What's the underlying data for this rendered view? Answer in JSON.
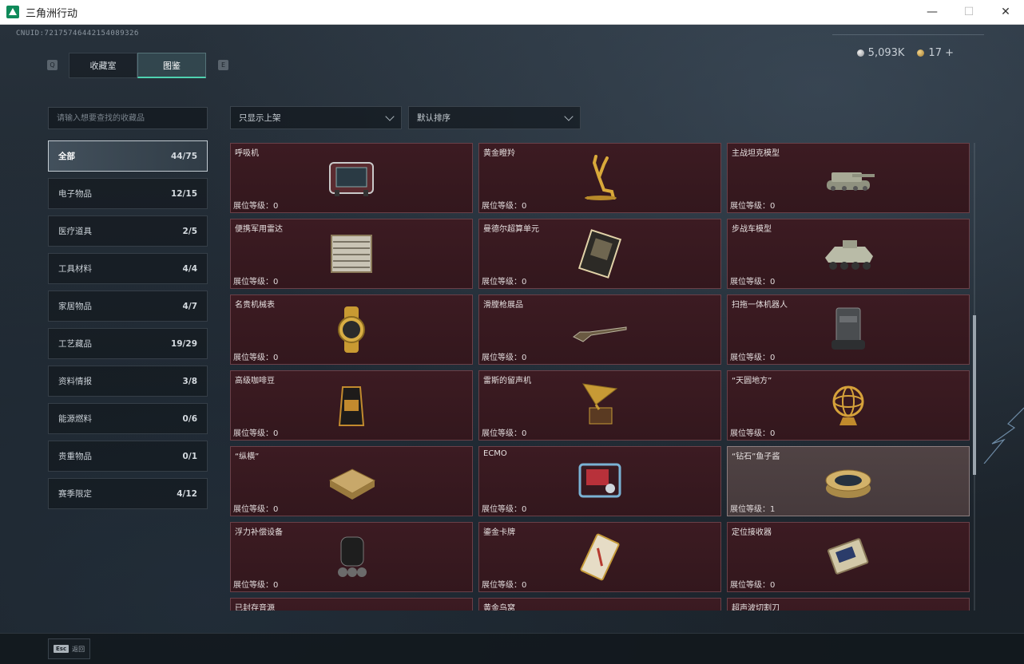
{
  "window": {
    "title": "三角洲行动",
    "minimize": "—",
    "maximize": "☐",
    "close": "✕"
  },
  "header": {
    "uid": "CNUID:7217574644215408932б",
    "currency": [
      {
        "icon": "silver-coin-icon",
        "value": "5,093K"
      },
      {
        "icon": "gold-coin-icon",
        "value": "17 +"
      }
    ]
  },
  "tabs": {
    "left_key": "Q",
    "right_key": "E",
    "items": [
      {
        "label": "收藏室",
        "active": false
      },
      {
        "label": "图鉴",
        "active": true
      }
    ]
  },
  "search": {
    "placeholder": "请输入想要查找的收藏品",
    "value": ""
  },
  "filters": {
    "availability": "只显示上架",
    "sort": "默认排序"
  },
  "categories": [
    {
      "label": "全部",
      "count": "44/75",
      "active": true
    },
    {
      "label": "电子物品",
      "count": "12/15",
      "active": false
    },
    {
      "label": "医疗道具",
      "count": "2/5",
      "active": false
    },
    {
      "label": "工具材料",
      "count": "4/4",
      "active": false
    },
    {
      "label": "家居物品",
      "count": "4/7",
      "active": false
    },
    {
      "label": "工艺藏品",
      "count": "19/29",
      "active": false
    },
    {
      "label": "资料情报",
      "count": "3/8",
      "active": false
    },
    {
      "label": "能源燃料",
      "count": "0/6",
      "active": false
    },
    {
      "label": "贵重物品",
      "count": "0/1",
      "active": false
    },
    {
      "label": "赛季限定",
      "count": "4/12",
      "active": false
    }
  ],
  "level_label": "展位等级：",
  "items": [
    {
      "name": "呼吸机",
      "level": "0",
      "icon": "ventilator-icon",
      "owned": false
    },
    {
      "name": "黄金瞪羚",
      "level": "0",
      "icon": "golden-gazelle-icon",
      "owned": false
    },
    {
      "name": "主战坦克模型",
      "level": "0",
      "icon": "tank-model-icon",
      "owned": false
    },
    {
      "name": "便携军用雷达",
      "level": "0",
      "icon": "radar-icon",
      "owned": false
    },
    {
      "name": "曼德尔超算单元",
      "level": "0",
      "icon": "supercomputer-unit-icon",
      "owned": false
    },
    {
      "name": "步战车模型",
      "level": "0",
      "icon": "ifv-model-icon",
      "owned": false
    },
    {
      "name": "名贵机械表",
      "level": "0",
      "icon": "watch-icon",
      "owned": false
    },
    {
      "name": "滑膛枪展品",
      "level": "0",
      "icon": "musket-icon",
      "owned": false
    },
    {
      "name": "扫拖一体机器人",
      "level": "0",
      "icon": "robot-vacuum-icon",
      "owned": false
    },
    {
      "name": "高级咖啡豆",
      "level": "0",
      "icon": "coffee-bag-icon",
      "owned": false
    },
    {
      "name": "雷斯的留声机",
      "level": "0",
      "icon": "gramophone-icon",
      "owned": false
    },
    {
      "name": "“天圆地方”",
      "level": "0",
      "icon": "armillary-sphere-icon",
      "owned": false
    },
    {
      "name": "“纵横”",
      "level": "0",
      "icon": "chess-box-icon",
      "owned": false
    },
    {
      "name": "ECMO",
      "level": "0",
      "icon": "ecmo-machine-icon",
      "owned": false
    },
    {
      "name": "“钻石”鱼子酱",
      "level": "1",
      "icon": "caviar-tin-icon",
      "owned": true
    },
    {
      "name": "浮力补偿设备",
      "level": "0",
      "icon": "bcd-gear-icon",
      "owned": false
    },
    {
      "name": "鎏金卡牌",
      "level": "0",
      "icon": "gilded-card-icon",
      "owned": false
    },
    {
      "name": "定位接收器",
      "level": "0",
      "icon": "gps-receiver-icon",
      "owned": false
    },
    {
      "name": "已封存音源",
      "level": "",
      "icon": "sealed-audio-icon",
      "owned": false
    },
    {
      "name": "黄金鸟窝",
      "level": "",
      "icon": "golden-nest-icon",
      "owned": false
    },
    {
      "name": "超声波切割刀",
      "level": "",
      "icon": "ultrasonic-cutter-icon",
      "owned": false
    }
  ],
  "footer": {
    "esc_key": "Esc",
    "back_label": "返回"
  }
}
